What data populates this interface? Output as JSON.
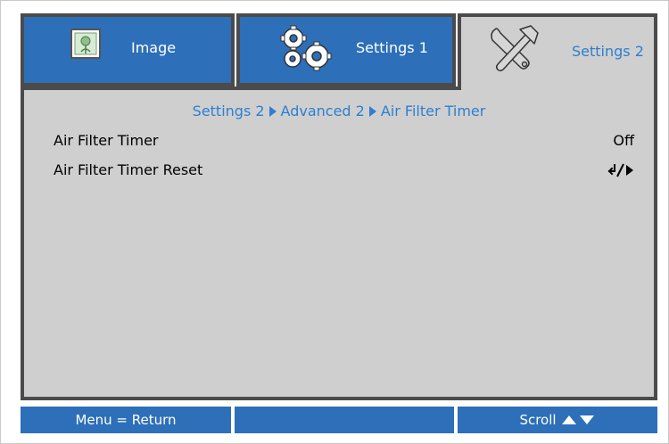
{
  "tabs": [
    {
      "label": "Image",
      "icon": "image-icon"
    },
    {
      "label": "Settings 1",
      "icon": "gears-icon"
    },
    {
      "label": "Settings 2",
      "icon": "tools-icon"
    }
  ],
  "breadcrumb": {
    "items": [
      "Settings 2",
      "Advanced 2",
      "Air Filter Timer"
    ],
    "separator_icon": "triangle-right-icon"
  },
  "menu": {
    "items": [
      {
        "label": "Air Filter Timer",
        "value": "Off"
      },
      {
        "label": "Air Filter Timer Reset",
        "value_icon": "enter-arrow-icon"
      }
    ]
  },
  "footer": {
    "left": "Menu = Return",
    "middle": "",
    "right": "Scroll",
    "right_icon": "up-down-triangles-icon"
  },
  "colors": {
    "tab_blue": "#2d6fb8",
    "accent_text": "#2d7fd0",
    "panel_gray": "#cfcfcf",
    "border_dark": "#4b4b4b"
  }
}
